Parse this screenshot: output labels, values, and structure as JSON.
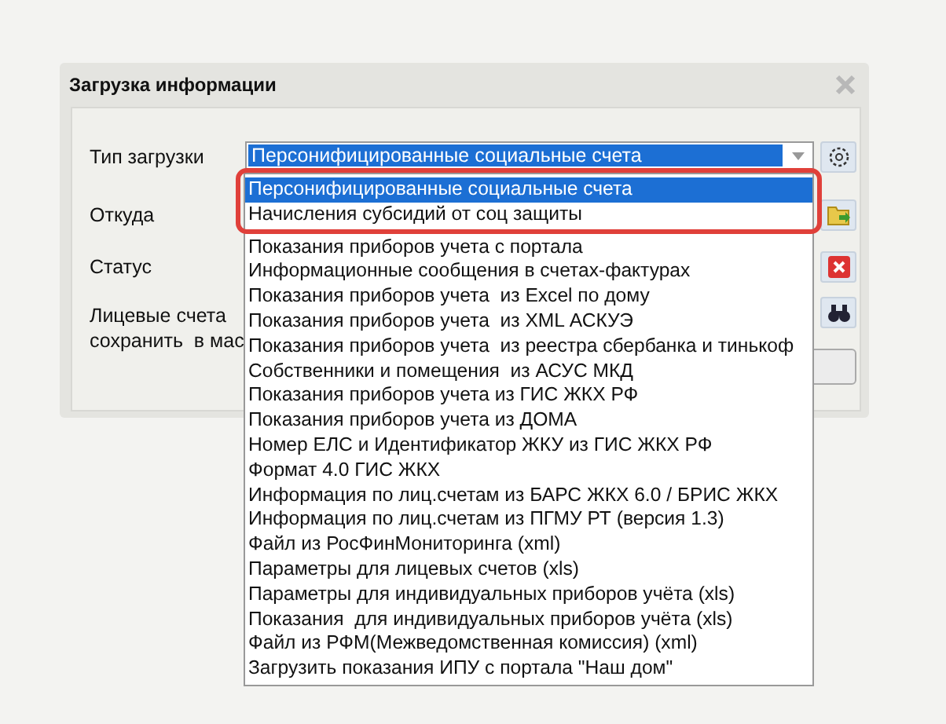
{
  "window": {
    "title": "Загрузка информации"
  },
  "rows": [
    {
      "kind": "combo",
      "label": "Тип загрузки",
      "value": "Персонифицированные социальные счета"
    },
    {
      "kind": "folder",
      "label": "Откуда"
    },
    {
      "kind": "delete",
      "label": "Статус"
    },
    {
      "kind": "search",
      "label": "Лицевые счета сохранить  в мас"
    }
  ],
  "dropdown": {
    "options": [
      {
        "label": "Персонифицированные социальные счета",
        "selected": true,
        "framed": true
      },
      {
        "label": "Начисления субсидий от соц защиты",
        "selected": false,
        "framed": true
      },
      {
        "label": "Показания приборов учета с портала",
        "selected": false,
        "framed": false
      },
      {
        "label": "Информационные сообщения в счетах-фактурах",
        "selected": false,
        "framed": false
      },
      {
        "label": "Показания приборов учета  из Excel по дому",
        "selected": false,
        "framed": false
      },
      {
        "label": "Показания приборов учета  из XML АСКУЭ",
        "selected": false,
        "framed": false
      },
      {
        "label": "Показания приборов учета  из реестра сбербанка и тинькоф",
        "selected": false,
        "framed": false
      },
      {
        "label": "Собственники и помещения  из АСУС МКД",
        "selected": false,
        "framed": false
      },
      {
        "label": "Показания приборов учета из ГИС ЖКХ РФ",
        "selected": false,
        "framed": false
      },
      {
        "label": "Показания приборов учета из ДОМА",
        "selected": false,
        "framed": false
      },
      {
        "label": "Номер ЕЛС и Идентификатор ЖКУ из ГИС ЖКХ РФ",
        "selected": false,
        "framed": false
      },
      {
        "label": "Формат 4.0 ГИС ЖКХ",
        "selected": false,
        "framed": false
      },
      {
        "label": "Информация по лиц.счетам из БАРС ЖКХ 6.0 / БРИС ЖКХ",
        "selected": false,
        "framed": false
      },
      {
        "label": "Информация по лиц.счетам из ПГМУ РТ (версия 1.3)",
        "selected": false,
        "framed": false
      },
      {
        "label": "Файл из РосФинМониторинга (xml)",
        "selected": false,
        "framed": false
      },
      {
        "label": "Параметры для лицевых счетов (xls)",
        "selected": false,
        "framed": false
      },
      {
        "label": "Параметры для индивидуальных приборов учёта (xls)",
        "selected": false,
        "framed": false
      },
      {
        "label": "Показания  для индивидуальных приборов учёта (xls)",
        "selected": false,
        "framed": false
      },
      {
        "label": "Файл из РФМ(Межведомственная комиссия) (xml)",
        "selected": false,
        "framed": false
      },
      {
        "label": "Загрузить показания ИПУ с портала \"Наш дом\"",
        "selected": false,
        "framed": false
      }
    ]
  }
}
